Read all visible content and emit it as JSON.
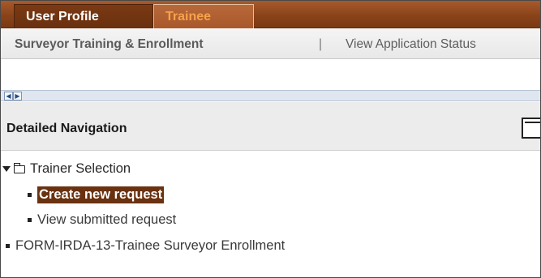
{
  "tabs": [
    {
      "label": "User Profile",
      "state": "inactive"
    },
    {
      "label": "Trainee",
      "state": "active"
    }
  ],
  "subnav": {
    "items": [
      "Surveyor Training & Enrollment",
      "View Application Status"
    ],
    "separator": "|"
  },
  "scroller": {
    "left_icon": "scroll-left-arrow-icon",
    "right_icon": "scroll-right-arrow-icon"
  },
  "detailed_navigation": {
    "title": "Detailed Navigation",
    "collapse_icon": "collapse-panel-icon"
  },
  "tree": {
    "folder": {
      "label": "Trainer Selection",
      "expanded": true,
      "children": [
        {
          "label": "Create new request",
          "selected": true
        },
        {
          "label": "View submitted request",
          "selected": false
        }
      ]
    },
    "root_items": [
      {
        "label": "FORM-IRDA-13-Trainee Surveyor Enrollment"
      }
    ]
  },
  "colors": {
    "tab_bar": "#8a4319",
    "active_tab_text": "#f6a24a",
    "selected_node_bg": "#6a3210"
  }
}
